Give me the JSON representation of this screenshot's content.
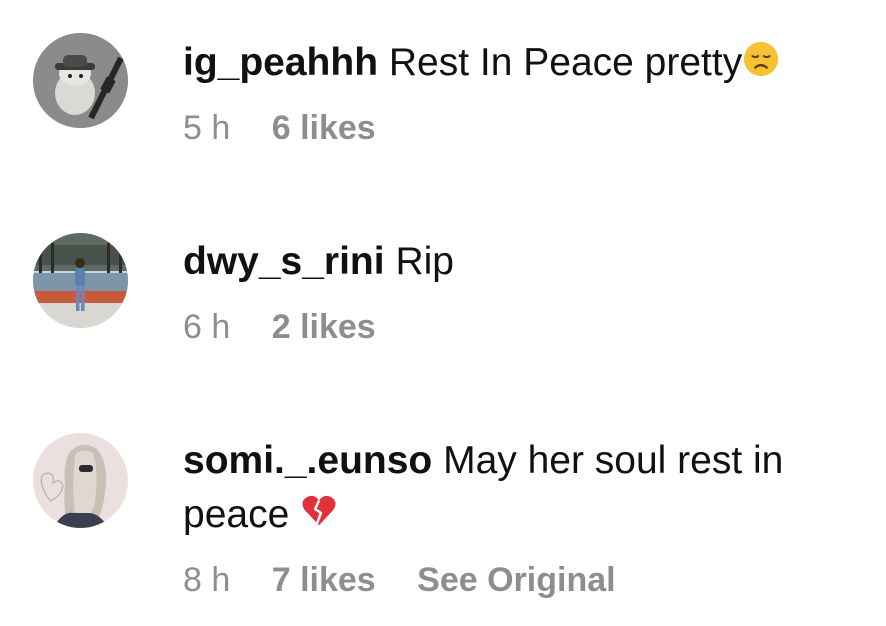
{
  "comments": [
    {
      "username": "ig_peahhh",
      "text": "Rest In Peace pretty",
      "emoji": "disappointed-face",
      "time": "5 h",
      "likes": "6 likes",
      "avatar": "avatar-ig-peahhh"
    },
    {
      "username": "dwy_s_rini",
      "text": "Rip",
      "time": "6 h",
      "likes": "2 likes",
      "avatar": "avatar-dwy-s-rini"
    },
    {
      "username": "somi._.eunso",
      "text": "May her soul rest in peace",
      "emoji": "broken-heart",
      "time": "8 h",
      "likes": "7 likes",
      "see_original": "See Original",
      "avatar": "avatar-somi-eunso"
    }
  ],
  "colors": {
    "text": "#111111",
    "meta": "#8e8e8e",
    "background": "#ffffff",
    "broken_heart": "#e0313b",
    "emoji_face": "#f6c234"
  }
}
